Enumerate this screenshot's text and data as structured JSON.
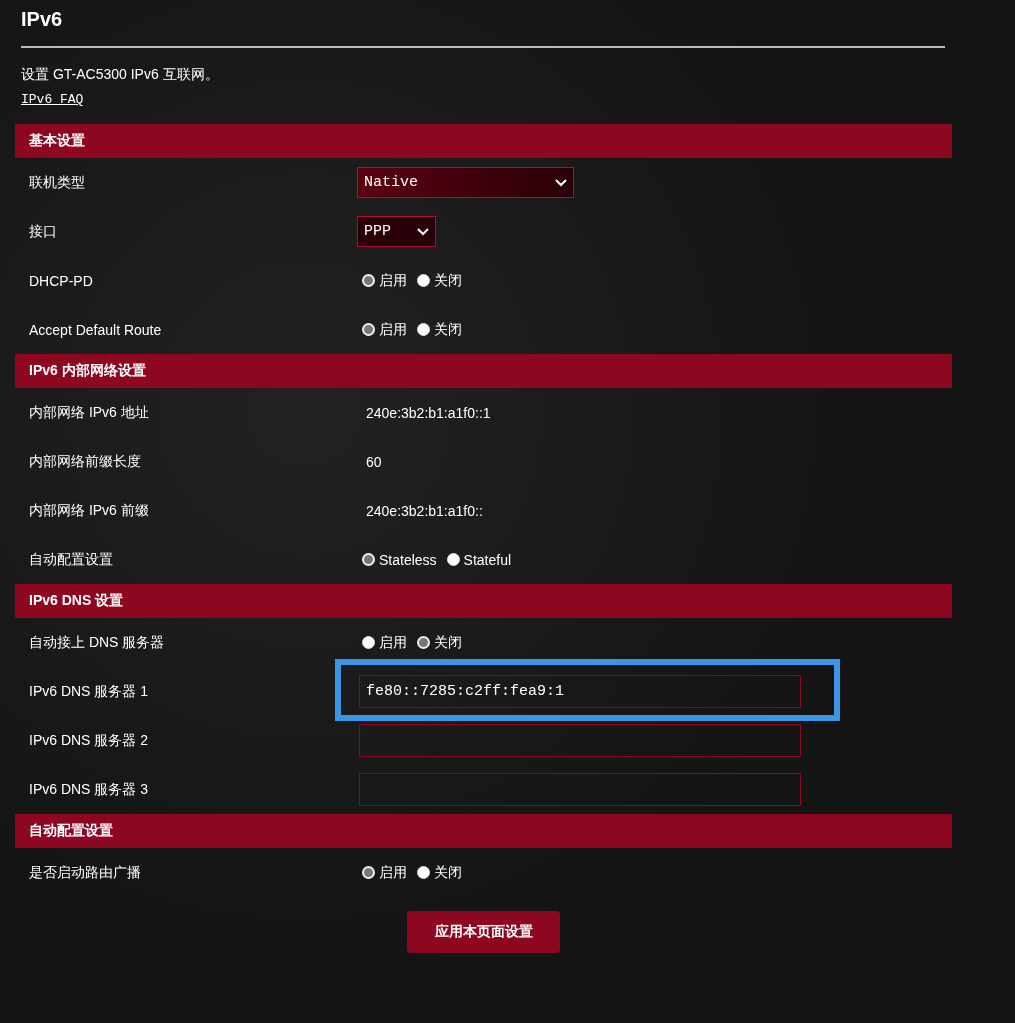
{
  "page": {
    "title": "IPv6",
    "description": "设置 GT-AC5300 IPv6 互联网。",
    "faq_link": "IPv6 FAQ"
  },
  "sections": [
    {
      "title": "基本设置",
      "rows": [
        {
          "label": "联机类型",
          "kind": "select",
          "value": "Native",
          "wide": true
        },
        {
          "label": "接口",
          "kind": "select",
          "value": "PPP",
          "wide": false
        },
        {
          "label": "DHCP-PD",
          "kind": "radio",
          "options": [
            {
              "label": "启用",
              "selected": true
            },
            {
              "label": "关闭",
              "selected": false
            }
          ]
        },
        {
          "label": "Accept Default Route",
          "kind": "radio",
          "options": [
            {
              "label": "启用",
              "selected": true
            },
            {
              "label": "关闭",
              "selected": false
            }
          ]
        }
      ]
    },
    {
      "title": "IPv6 内部网络设置",
      "rows": [
        {
          "label": "内部网络 IPv6 地址",
          "kind": "text",
          "value": "240e:3b2:b1:a1f0::1"
        },
        {
          "label": "内部网络前缀长度",
          "kind": "text",
          "value": "60"
        },
        {
          "label": "内部网络 IPv6 前缀",
          "kind": "text",
          "value": "240e:3b2:b1:a1f0::"
        },
        {
          "label": "自动配置设置",
          "kind": "radio",
          "options": [
            {
              "label": "Stateless",
              "selected": true
            },
            {
              "label": "Stateful",
              "selected": false
            }
          ]
        }
      ]
    },
    {
      "title": "IPv6 DNS 设置",
      "rows": [
        {
          "label": "自动接上 DNS 服务器",
          "kind": "radio",
          "options": [
            {
              "label": "启用",
              "selected": false
            },
            {
              "label": "关闭",
              "selected": true
            }
          ]
        },
        {
          "label": "IPv6 DNS 服务器 1",
          "kind": "input",
          "value": "fe80::7285:c2ff:fea9:1",
          "highlighted": true
        },
        {
          "label": "IPv6 DNS 服务器 2",
          "kind": "input",
          "highlighted": false
        },
        {
          "label": "IPv6 DNS 服务器 3",
          "kind": "input",
          "highlighted": false
        }
      ]
    },
    {
      "title": "自动配置设置",
      "rows": [
        {
          "label": "是否启动路由广播",
          "kind": "radio",
          "options": [
            {
              "label": "启用",
              "selected": true
            },
            {
              "label": "关闭",
              "selected": false
            }
          ]
        }
      ]
    }
  ],
  "apply_button": "应用本页面设置"
}
